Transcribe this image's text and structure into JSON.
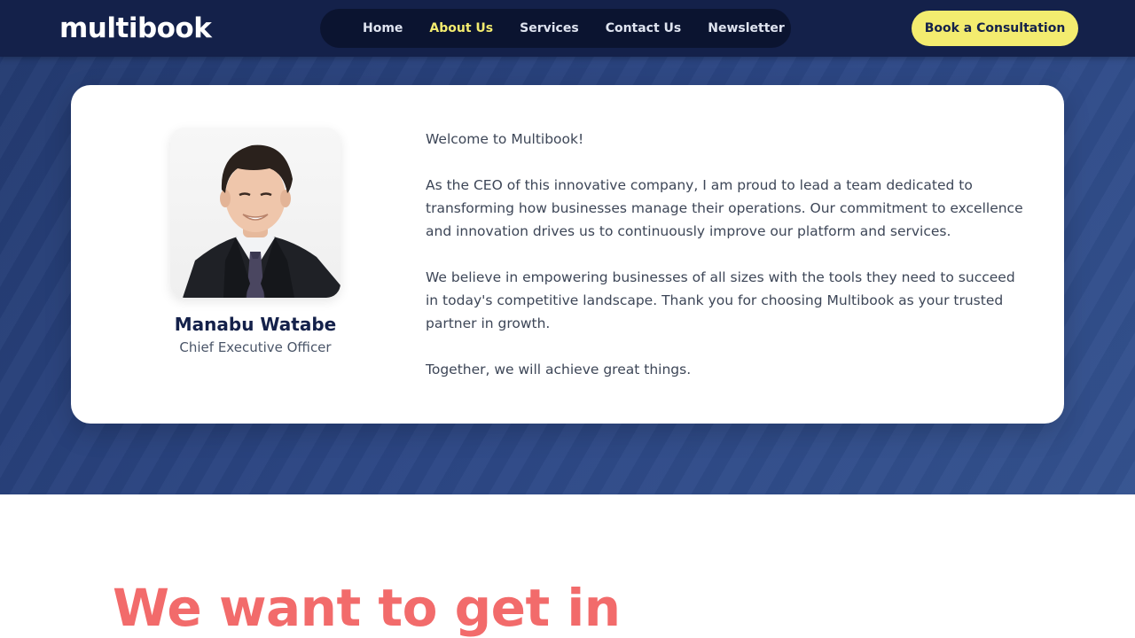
{
  "header": {
    "logo": "multibook",
    "nav": [
      {
        "label": "Home",
        "active": false
      },
      {
        "label": "About Us",
        "active": true
      },
      {
        "label": "Services",
        "active": false
      },
      {
        "label": "Contact Us",
        "active": false
      },
      {
        "label": "Newsletter",
        "active": false
      }
    ],
    "cta_label": "Book a Consultation"
  },
  "ceo_card": {
    "name": "Manabu Watabe",
    "title": "Chief Executive Officer",
    "paragraphs": [
      "Welcome to Multibook!",
      "As the CEO of this innovative company, I am proud to lead a team dedicated to transforming how businesses manage their operations. Our commitment to excellence and innovation drives us to continuously improve our platform and services.",
      "We believe in empowering businesses of all sizes with the tools they need to succeed in today's competitive landscape. Thank you for choosing Multibook as your trusted partner in growth.",
      "Together, we will achieve great things."
    ]
  },
  "contact_section": {
    "heading": "We want to get in"
  },
  "colors": {
    "navy": "#14214a",
    "accent_yellow": "#f3ec6f",
    "coral": "#f26b6b",
    "hero_blue": "#2c4785"
  }
}
